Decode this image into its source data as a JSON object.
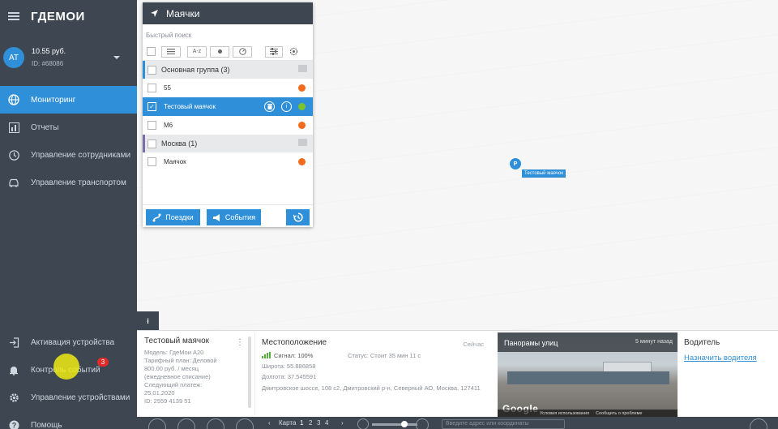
{
  "app": {
    "logo": "ГДЕМОИ"
  },
  "account": {
    "initials": "AT",
    "balance": "10.55 руб.",
    "id": "ID: #68086"
  },
  "sidebar": {
    "items": [
      {
        "label": "Мониторинг",
        "icon": "globe-icon",
        "active": true
      },
      {
        "label": "Отчеты",
        "icon": "chart-icon"
      },
      {
        "label": "Управление сотрудниками",
        "icon": "clock-icon"
      },
      {
        "label": "Управление транспортом",
        "icon": "car-icon"
      }
    ],
    "bottom_items": [
      {
        "label": "Активация устройства",
        "icon": "login-icon"
      },
      {
        "label": "Контроль событий",
        "icon": "bell-icon",
        "badge": "3"
      },
      {
        "label": "Управление устройствами",
        "icon": "gear-icon"
      },
      {
        "label": "Помощь",
        "icon": "help-icon"
      }
    ]
  },
  "panel": {
    "title": "Маячки",
    "search_placeholder": "Быстрый поиск",
    "sort_label": "A-z",
    "groups": [
      {
        "name": "Основная группа (3)",
        "items": [
          {
            "name": "55",
            "status_color": "#f26b1d",
            "selected": false
          },
          {
            "name": "Тестовый маячок",
            "status_color": "#7bc42a",
            "selected": true
          },
          {
            "name": "М6",
            "status_color": "#f26b1d",
            "selected": false
          }
        ]
      },
      {
        "name": "Москва (1)",
        "items": [
          {
            "name": "Маячок",
            "status_color": "#f26b1d",
            "selected": false
          }
        ]
      }
    ],
    "buttons": {
      "trips": "Поездки",
      "events": "События"
    }
  },
  "map": {
    "marker_letter": "P",
    "marker_label": "Тестовый маячок",
    "info_tab": "i"
  },
  "details": {
    "device": {
      "title": "Тестовый маячок",
      "lines": [
        "Модель: ГдеМои А20",
        "Тарифный план: Деловой",
        "800.00 руб. / месяц",
        "(ежедневное списание)",
        "Следующий платеж:",
        "25.01.2020",
        "ID: 2559 4139 51"
      ]
    },
    "location": {
      "title": "Местоположение",
      "now": "Сейчас",
      "signal": "Сигнал: 100%",
      "status": "Статус: Стоит 35 мин 11 с",
      "lat": "Широта: 55.886858",
      "lon": "Долгота: 37.545591",
      "address": "Дмитровское шоссе, 108 с2, Дмитровский р-н, Северный АО, Москва, 127411"
    },
    "panorama": {
      "title": "Панорамы улиц",
      "ago": "5 минут назад",
      "brand": "Google",
      "footer": [
        "Условия использования",
        "Сообщить о проблеме"
      ]
    },
    "driver": {
      "title": "Водитель",
      "assign_link": "Назначить водителя"
    }
  },
  "bottombar": {
    "card_label": "Карта",
    "page": "1",
    "pages": [
      "2",
      "3",
      "4"
    ],
    "address_placeholder": "Введите адрес или координаты"
  }
}
